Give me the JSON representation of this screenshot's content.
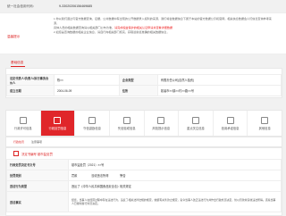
{
  "credit_code_label": "统一社会信用代码：",
  "credit_code_value": "9-33020206156469685",
  "notice": {
    "label": "温馨提示",
    "text_line1": "1.你以我们通过与官方数据查询、证据，公共数据中有出现的公开数据录入权利的来源，我们将会数据信息下属于本站的官方数据公示和官网，相关信息数据会人们信息查询参考来源，",
    "text_line2": "具体人员的相关数据查询请以相关部门公布为准，",
    "text_red": "请完成权益保护的相关认证申请并查看详细数据",
    "text_line3": "2.如您是查询数据的相关企业信息，请自行向相关部门核实，获取最新最准确的相关数据信息，"
  },
  "basic": {
    "section_title": "基础信息",
    "rows": [
      {
        "k1": "法定代表人/负责人/执行事务合伙人",
        "v1": "陈××",
        "k2": "企业类型",
        "v2": "有限责任公司(自然人独资)"
      },
      {
        "k1": "成立日期",
        "v1": "2004-06-09",
        "k2": "住所",
        "v2": "慈溪市××镇××村××路××号"
      }
    ]
  },
  "tabs": [
    {
      "label": "行政许可信息",
      "active": false
    },
    {
      "label": "行政处罚信息",
      "active": true
    },
    {
      "label": "守信激励信息",
      "active": false
    },
    {
      "label": "失信惩戒信息",
      "active": false
    },
    {
      "label": "风险提示信息",
      "active": false
    },
    {
      "label": "重点关注信息",
      "active": false
    },
    {
      "label": "信用承诺信息",
      "active": false
    },
    {
      "label": "其他信息",
      "active": false
    }
  ],
  "subtabs": [
    "行政处罚",
    "注意事项"
  ],
  "penalty": {
    "header": "决定书编号 慈市监处罚",
    "rows": [
      {
        "k": "行政处罚决定书文号",
        "v": "慈市监处罚〔2021〕××号"
      },
      {
        "k": "处罚类别",
        "v": "罚款　　　　　没收违法所得　　　　警告"
      },
      {
        "k": "违法行为类型",
        "v": "违反了《中华人民共和国食品安全法》相关规定"
      },
      {
        "k": "违法事实",
        "v": "经查，当事人在经营过程中存在违法行为，违反了相关法律法规的规定，依据有关条款之规定，责令当事人改正违法行为并作出行政处罚决定，处以罚款并没收违法所得。该案当事人已按时履行处罚决定。"
      }
    ]
  }
}
